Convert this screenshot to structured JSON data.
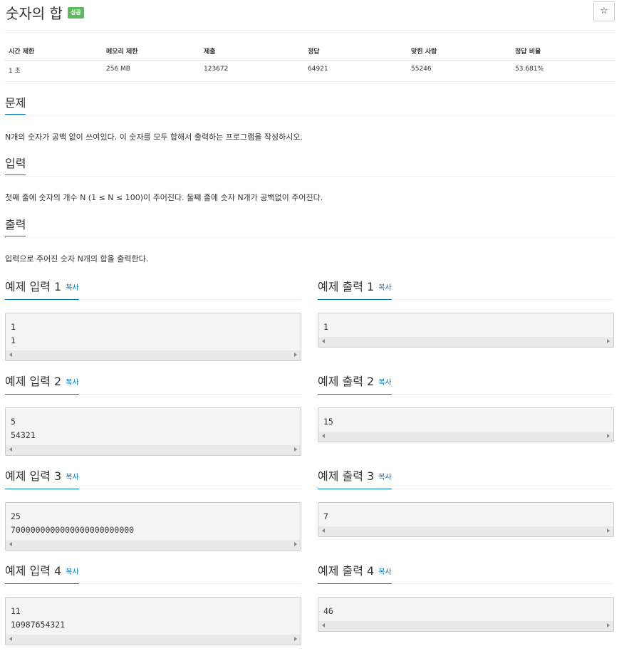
{
  "problem": {
    "title": "숫자의 합",
    "badge": "성공",
    "star_icon": "☆"
  },
  "stats": {
    "headers": [
      "시간 제한",
      "메모리 제한",
      "제출",
      "정답",
      "맞힌 사람",
      "정답 비율"
    ],
    "values": [
      "1 초",
      "256 MB",
      "123672",
      "64921",
      "55246",
      "53.681%"
    ]
  },
  "sections": {
    "problem": {
      "title": "문제",
      "text": "N개의 숫자가 공백 없이 쓰여있다. 이 숫자를 모두 합해서 출력하는 프로그램을 작성하시오."
    },
    "input": {
      "title": "입력",
      "text": "첫째 줄에 숫자의 개수 N (1 ≤ N ≤ 100)이 주어진다. 둘째 줄에 숫자 N개가 공백없이 주어진다."
    },
    "output": {
      "title": "출력",
      "text": "입력으로 주어진 숫자 N개의 합을 출력한다."
    }
  },
  "copy_label": "복사",
  "samples": [
    {
      "in_title": "예제 입력 1",
      "in": "1\n1",
      "out_title": "예제 출력 1",
      "out": "1"
    },
    {
      "in_title": "예제 입력 2",
      "in": "5\n54321",
      "out_title": "예제 출력 2",
      "out": "15"
    },
    {
      "in_title": "예제 입력 3",
      "in": "25\n7000000000000000000000000",
      "out_title": "예제 출력 3",
      "out": "7"
    },
    {
      "in_title": "예제 입력 4",
      "in": "11\n10987654321",
      "out_title": "예제 출력 4",
      "out": "46"
    }
  ]
}
